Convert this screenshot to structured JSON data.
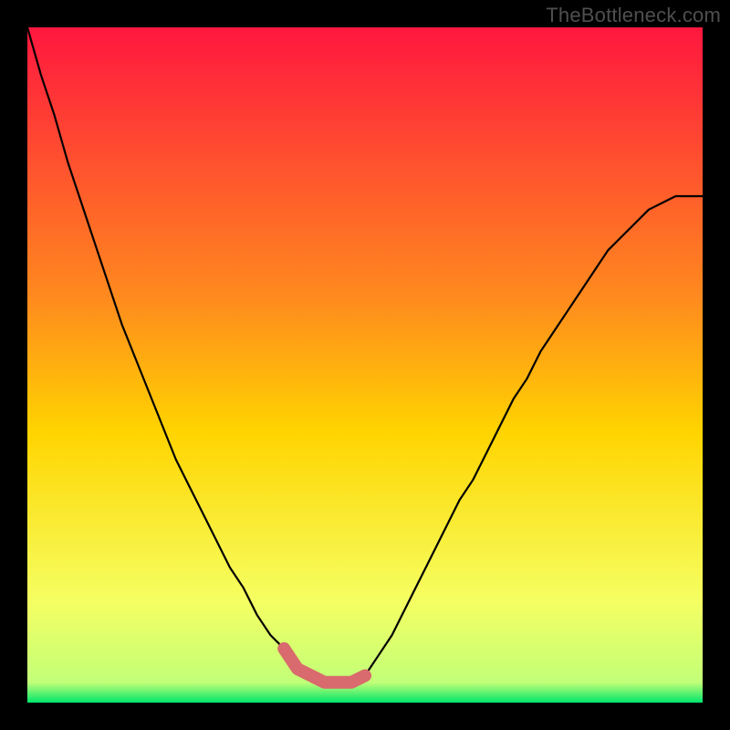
{
  "watermark": "TheBottleneck.com",
  "colors": {
    "background": "#000000",
    "gradient_top": "#ff173f",
    "gradient_mid": "#ffd400",
    "gradient_bottom": "#00e56b",
    "curve": "#000000",
    "highlight": "#d96a6d",
    "watermark": "#4f4f4f"
  },
  "chart_data": {
    "type": "line",
    "title": "",
    "xlabel": "",
    "ylabel": "",
    "xlim": [
      0,
      1
    ],
    "ylim": [
      0,
      1
    ],
    "x": [
      0.0,
      0.02,
      0.04,
      0.06,
      0.08,
      0.1,
      0.12,
      0.14,
      0.16,
      0.18,
      0.2,
      0.22,
      0.24,
      0.26,
      0.28,
      0.3,
      0.32,
      0.34,
      0.36,
      0.38,
      0.4,
      0.42,
      0.44,
      0.46,
      0.48,
      0.5,
      0.52,
      0.54,
      0.56,
      0.58,
      0.6,
      0.62,
      0.64,
      0.66,
      0.68,
      0.7,
      0.72,
      0.74,
      0.76,
      0.78,
      0.8,
      0.82,
      0.84,
      0.86,
      0.88,
      0.9,
      0.92,
      0.94,
      0.96,
      0.98,
      1.0
    ],
    "values": [
      1.0,
      0.93,
      0.87,
      0.8,
      0.74,
      0.68,
      0.62,
      0.56,
      0.51,
      0.46,
      0.41,
      0.36,
      0.32,
      0.28,
      0.24,
      0.2,
      0.17,
      0.13,
      0.1,
      0.08,
      0.05,
      0.04,
      0.03,
      0.03,
      0.03,
      0.04,
      0.07,
      0.1,
      0.14,
      0.18,
      0.22,
      0.26,
      0.3,
      0.33,
      0.37,
      0.41,
      0.45,
      0.48,
      0.52,
      0.55,
      0.58,
      0.61,
      0.64,
      0.67,
      0.69,
      0.71,
      0.73,
      0.74,
      0.75,
      0.75,
      0.75
    ],
    "highlight": {
      "x_range": [
        0.37,
        0.5
      ],
      "y_max": 0.1,
      "color": "#d96a6d"
    },
    "background_gradient": {
      "direction": "vertical",
      "stops": [
        {
          "pos": 0.0,
          "color": "#ff173f"
        },
        {
          "pos": 0.4,
          "color": "#ff8a1e"
        },
        {
          "pos": 0.6,
          "color": "#ffd400"
        },
        {
          "pos": 0.85,
          "color": "#f5ff62"
        },
        {
          "pos": 0.97,
          "color": "#c2ff78"
        },
        {
          "pos": 1.0,
          "color": "#00e56b"
        }
      ]
    }
  }
}
